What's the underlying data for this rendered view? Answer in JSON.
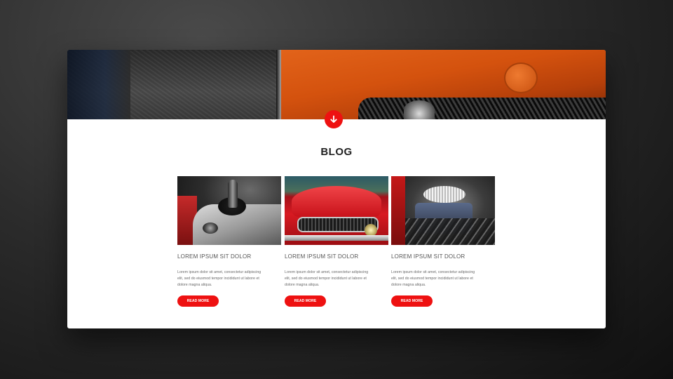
{
  "section": {
    "title": "BLOG"
  },
  "posts": [
    {
      "title": "LOREM IPSUM SIT DOLOR",
      "excerpt": "Lorem ipsum dolor sit amet, consectetur adipiscing elit, sed do eiusmod tempor incididunt ut labore et dolore magna aliqua.",
      "button": "READ MORE",
      "image": "gear-shift-photo"
    },
    {
      "title": "LOREM IPSUM SIT DOLOR",
      "excerpt": "Lorem ipsum dolor sit amet, consectetur adipiscing elit, sed do eiusmod tempor incididunt ut labore et dolore magna aliqua.",
      "button": "READ MORE",
      "image": "red-mustang-photo"
    },
    {
      "title": "LOREM IPSUM SIT DOLOR",
      "excerpt": "Lorem ipsum dolor sit amet, consectetur adipiscing elit, sed do eiusmod tempor incididunt ut labore et dolore magna aliqua.",
      "button": "READ MORE",
      "image": "engine-photo"
    }
  ],
  "icons": {
    "scroll_down": "arrow-down-icon"
  },
  "colors": {
    "accent": "#ee1111",
    "title": "#222222",
    "text": "#6a6a6a",
    "background_card": "#ffffff"
  }
}
